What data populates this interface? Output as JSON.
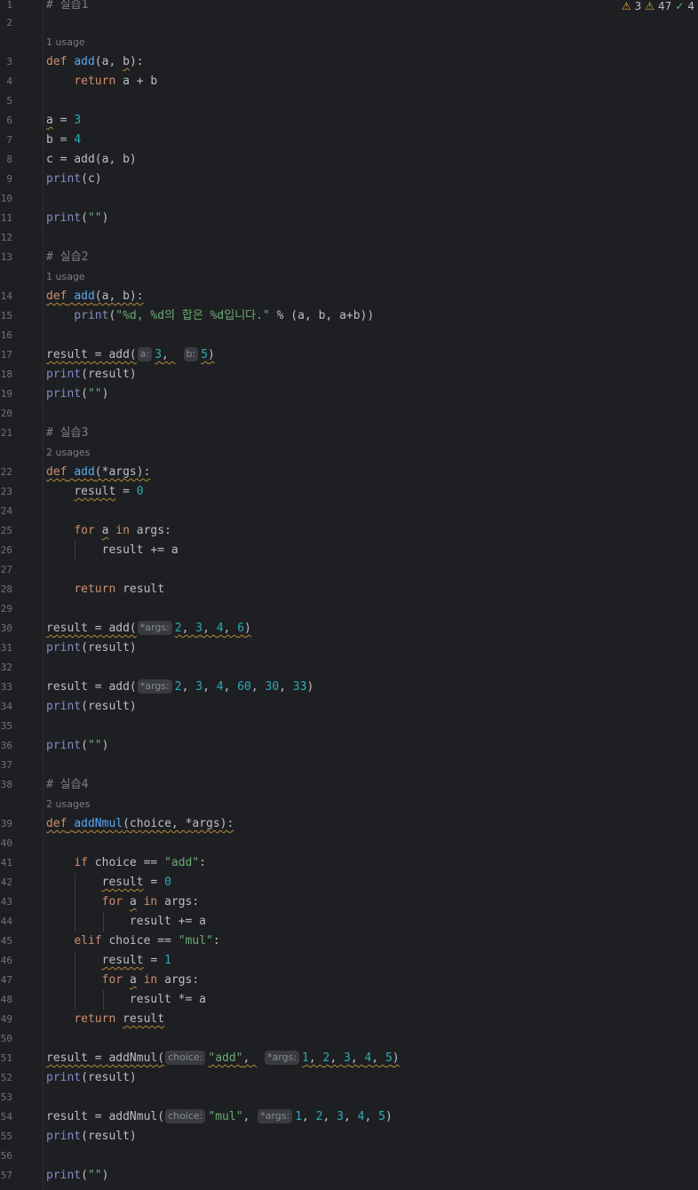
{
  "status": {
    "errors_count": "3",
    "warnings_count": "47",
    "weak_count": "4",
    "icons": [
      "warning-icon",
      "warning-icon",
      "check-icon"
    ]
  },
  "usages": {
    "u1": "1 usage",
    "u2": "1 usage",
    "u3": "2 usages",
    "u4": "2 usages"
  },
  "hints": {
    "a": "a:",
    "b": "b:",
    "args": "*args:",
    "choice": "choice:"
  },
  "code": {
    "c1": "# 실습1",
    "s15": "\"%d, %d의 합은 %d입니다.\"",
    "c21": "# 실습2",
    "c29": "# 실습3",
    "c43": "# 실습4",
    "s_add": "\"add\"",
    "s_mul": "\"mul\"",
    "s_empty": "\"\""
  }
}
